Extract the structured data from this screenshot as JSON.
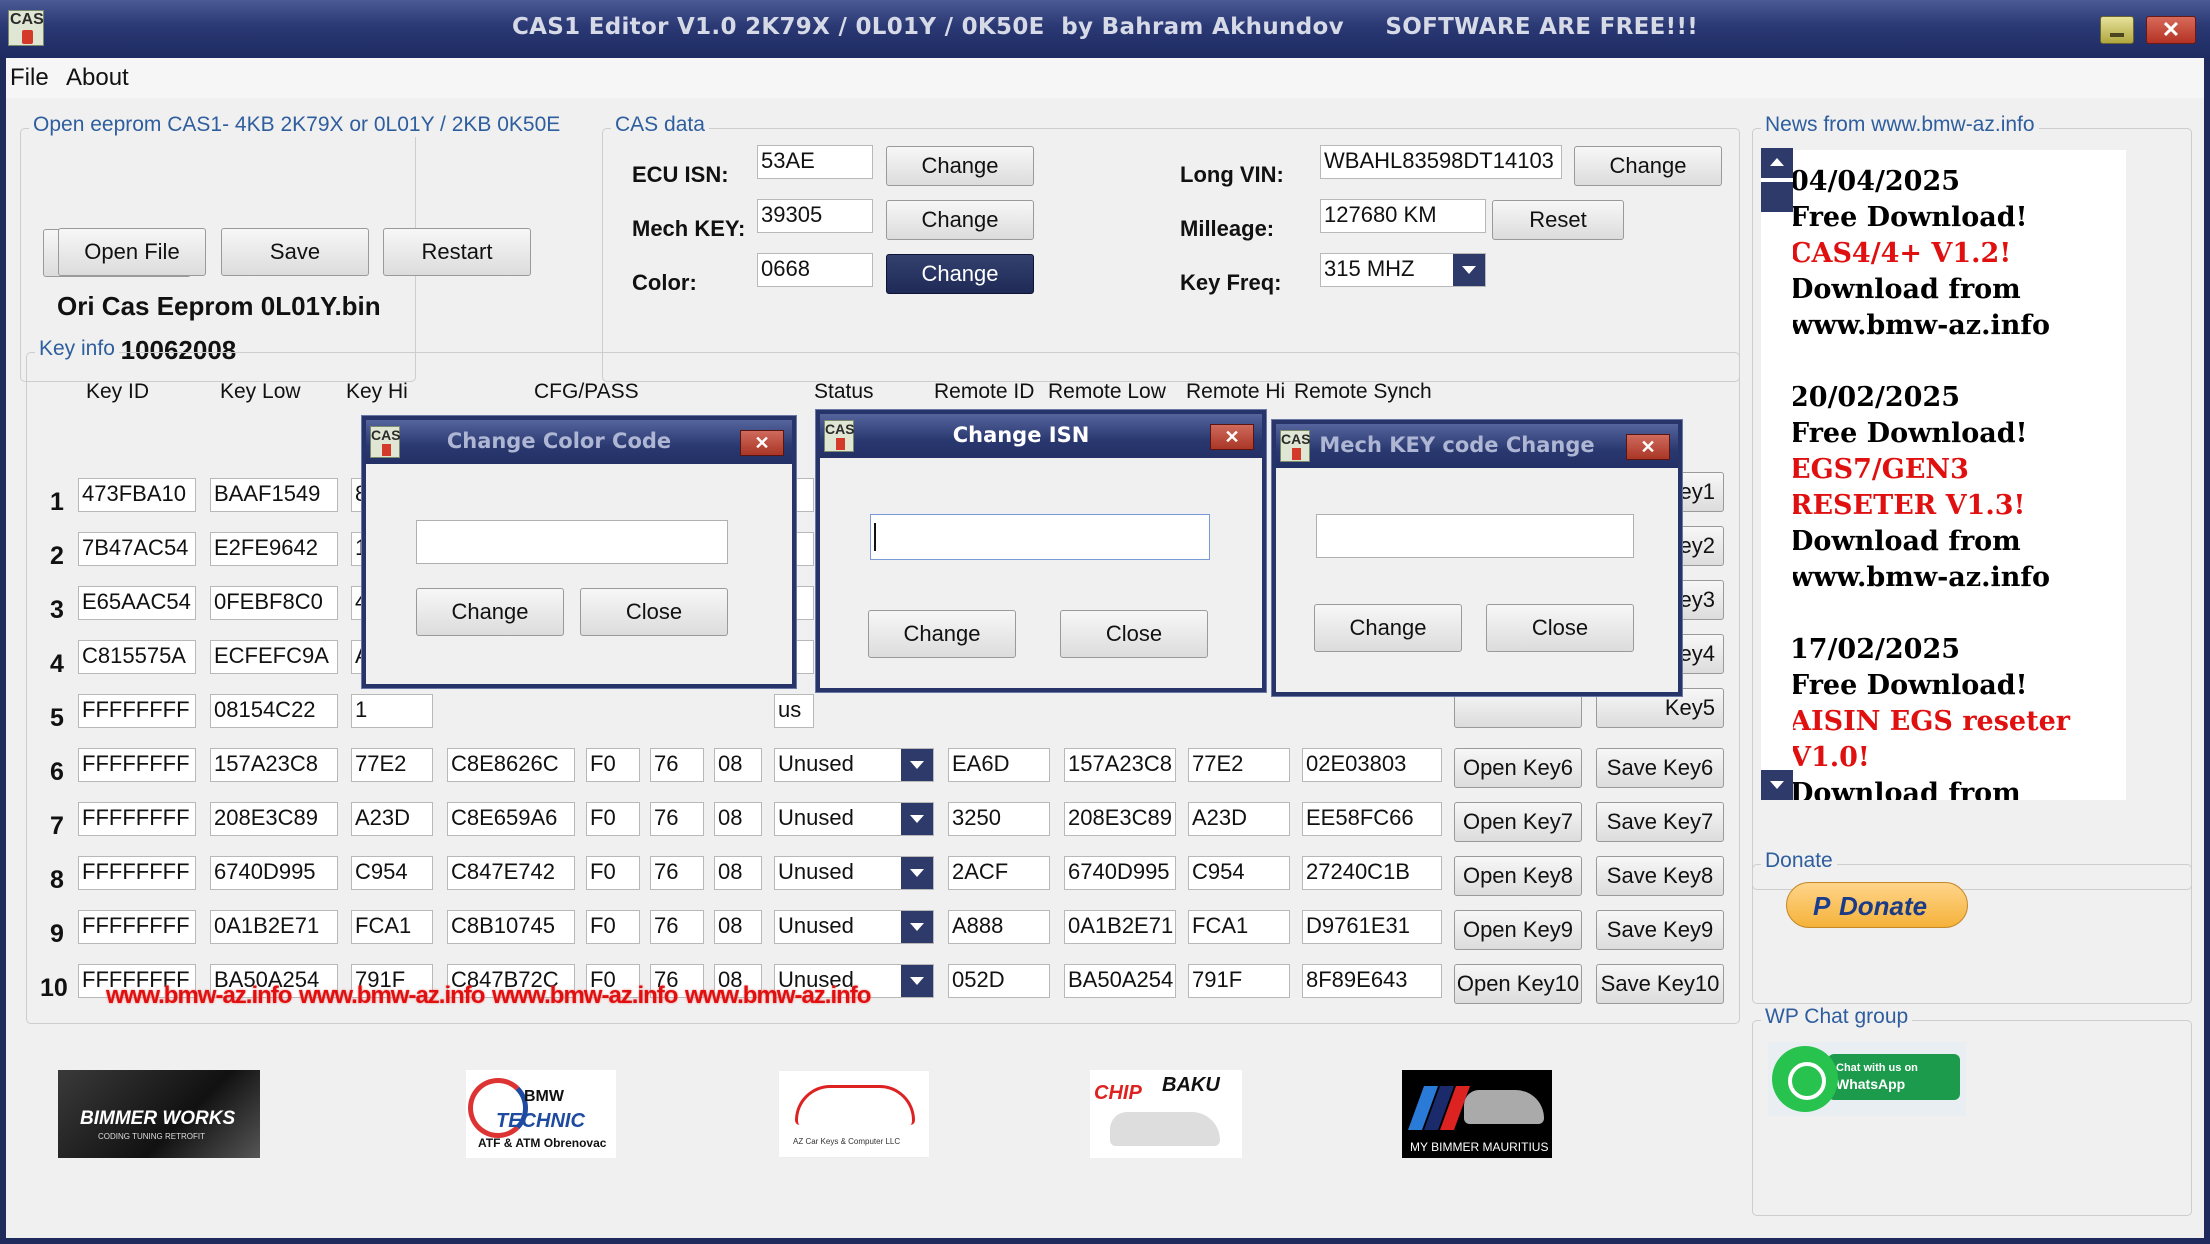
{
  "window": {
    "title": "CAS1 Editor V1.0 2K79X / 0L01Y / 0K50E  by Bahram Akhundov     SOFTWARE ARE FREE!!!",
    "icon_text": "CAS",
    "close_glyph": "✕"
  },
  "menu": [
    "File",
    "About"
  ],
  "open_group": {
    "label": "Open eeprom CAS1- 4KB 2K79X or 0L01Y / 2KB 0K50E",
    "open_btn": "Open File",
    "save_btn": "Save",
    "restart_btn": "Restart",
    "file_name": "Ori Cas Eeprom 0L01Y.bin",
    "data_date": "Data 10062008"
  },
  "cas_data": {
    "label": "CAS data",
    "isn_label": "ECU ISN:",
    "isn": "53AE",
    "mech_label": "Mech KEY:",
    "mech": "39305",
    "color_label": "Color:",
    "color": "0668",
    "change": "Change",
    "vin_label": "Long VIN:",
    "vin": "WBAHL83598DT14103",
    "mileage_label": "Milleage:",
    "mileage": "127680 KM",
    "reset": "Reset",
    "freq_label": "Key Freq:",
    "freq": "315 MHZ"
  },
  "key_info": {
    "label": "Key info",
    "headers": [
      "Key ID",
      "Key Low",
      "Key Hi",
      "CFG/PASS",
      "Status",
      "Remote ID",
      "Remote Low",
      "Remote Hi",
      "Remote Synch"
    ],
    "rows": [
      {
        "n": "1",
        "id": "473FBA10",
        "low": "BAAF1549",
        "hi": "8",
        "save": "Key1"
      },
      {
        "n": "2",
        "id": "7B47AC54",
        "low": "E2FE9642",
        "hi": "1",
        "save": "Key2"
      },
      {
        "n": "3",
        "id": "E65AAC54",
        "low": "0FEBF8C0",
        "hi": "4",
        "save": "Key3"
      },
      {
        "n": "4",
        "id": "C815575A",
        "low": "ECFEFC9A",
        "hi": "A",
        "save": "Key4"
      },
      {
        "n": "5",
        "id": "FFFFFFFF",
        "low": "08154C22",
        "hi": "1",
        "save": "Key5"
      },
      {
        "n": "6",
        "id": "FFFFFFFF",
        "low": "157A23C8",
        "hi": "77E2",
        "cfg": "C8E8626C",
        "c1": "F0",
        "c2": "76",
        "c3": "08",
        "status": "Unused",
        "rid": "EA6D",
        "rlow": "157A23C8",
        "rhi": "77E2",
        "rsync": "02E03803",
        "open": "Open Key6",
        "save": "Save Key6"
      },
      {
        "n": "7",
        "id": "FFFFFFFF",
        "low": "208E3C89",
        "hi": "A23D",
        "cfg": "C8E659A6",
        "c1": "F0",
        "c2": "76",
        "c3": "08",
        "status": "Unused",
        "rid": "3250",
        "rlow": "208E3C89",
        "rhi": "A23D",
        "rsync": "EE58FC66",
        "open": "Open Key7",
        "save": "Save Key7"
      },
      {
        "n": "8",
        "id": "FFFFFFFF",
        "low": "6740D995",
        "hi": "C954",
        "cfg": "C847E742",
        "c1": "F0",
        "c2": "76",
        "c3": "08",
        "status": "Unused",
        "rid": "2ACF",
        "rlow": "6740D995",
        "rhi": "C954",
        "rsync": "27240C1B",
        "open": "Open Key8",
        "save": "Save Key8"
      },
      {
        "n": "9",
        "id": "FFFFFFFF",
        "low": "0A1B2E71",
        "hi": "FCA1",
        "cfg": "C8B10745",
        "c1": "F0",
        "c2": "76",
        "c3": "08",
        "status": "Unused",
        "rid": "A888",
        "rlow": "0A1B2E71",
        "rhi": "FCA1",
        "rsync": "D9761E31",
        "open": "Open Key9",
        "save": "Save Key9"
      },
      {
        "n": "10",
        "id": "FFFFFFFF",
        "low": "BA50A254",
        "hi": "791F",
        "cfg": "C847B72C",
        "c1": "F0",
        "c2": "76",
        "c3": "08",
        "status": "Unused",
        "rid": "052D",
        "rlow": "BA50A254",
        "rhi": "791F",
        "rsync": "8F89E643",
        "open": "Open Key10",
        "save": "Save Key10"
      }
    ],
    "status_partial": [
      "rv",
      "yl",
      "yl",
      "yl",
      "us"
    ]
  },
  "dialogs": {
    "color": {
      "title": "Change Color Code",
      "change": "Change",
      "close": "Close"
    },
    "isn": {
      "title": "Change ISN",
      "change": "Change",
      "close": "Close"
    },
    "mech": {
      "title": "Mech KEY code Change",
      "change": "Change",
      "close": "Close"
    }
  },
  "news": {
    "label": "News from www.bmw-az.info",
    "items": [
      {
        "date": "04/04/2025",
        "l1": "Free Download!",
        "red": [
          "CAS4/4+ V1.2!"
        ],
        "l3": "Download from",
        "l4": "www.bmw-az.info"
      },
      {
        "date": "20/02/2025",
        "l1": "Free Download!",
        "red": [
          "EGS7/GEN3",
          "RESETER V1.3!"
        ],
        "l3": "Download from",
        "l4": "www.bmw-az.info"
      },
      {
        "date": "17/02/2025",
        "l1": "Free Download!",
        "red": [
          "AISIN EGS reseter",
          "V1.0!"
        ],
        "l3": "Download from",
        "l4": ""
      }
    ]
  },
  "donate": {
    "label": "Donate",
    "button": "Donate",
    "p": "P"
  },
  "wp": {
    "label": "WP Chat group",
    "line1": "Chat with us on",
    "line2": "WhatsApp"
  },
  "links": [
    "www.bmw-az.info",
    "www.bmw-az.info",
    "www.bmw-az.info",
    "www.bmw-az.info"
  ],
  "logos": {
    "bimmer": "BIMMER WORKS",
    "bimmer_sub": "CODING TUNING RETROFIT",
    "technic_top": "BMW",
    "technic_mid": "TECHNIC",
    "technic_bot": "ATF & ATM Obrenovac",
    "az": "AZ Car Keys & Computer LLC",
    "chip": "CHIP",
    "baku": "BAKU",
    "mauritius": "MY BIMMER MAURITIUS"
  },
  "colors": {
    "title_bg": "#2a3874",
    "group_label": "#2f5e9e",
    "news_red": "#e01010"
  }
}
